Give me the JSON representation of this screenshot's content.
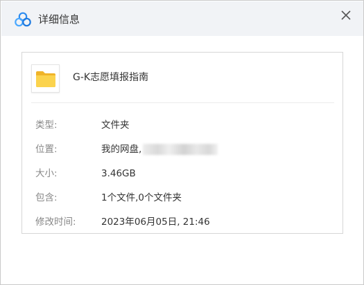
{
  "window": {
    "title": "详细信息"
  },
  "file": {
    "name": "G-K志愿填报指南",
    "icon": "folder-icon",
    "accent": "#f7c93e"
  },
  "details": {
    "type": {
      "label": "类型:",
      "value": "文件夹"
    },
    "location": {
      "label": "位置:",
      "value": "我的网盘,"
    },
    "size": {
      "label": "大小:",
      "value": "3.46GB"
    },
    "contains": {
      "label": "包含:",
      "value": "1个文件,0个文件夹"
    },
    "modified": {
      "label": "修改时间:",
      "value": "2023年06月05日, 21:46"
    }
  }
}
